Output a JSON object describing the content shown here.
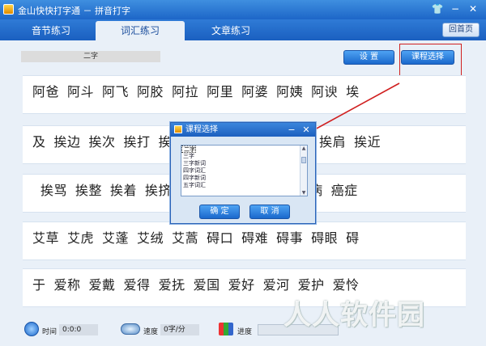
{
  "window": {
    "title": "金山快快打字通 － 拼音打字",
    "buttons": [
      "shirt-icon",
      "minimize-icon",
      "close-icon"
    ]
  },
  "tabs": [
    {
      "label": "音节练习",
      "active": false
    },
    {
      "label": "词汇练习",
      "active": true
    },
    {
      "label": "文章练习",
      "active": false
    }
  ],
  "home_button": "回首页",
  "course_label": "二字",
  "settings_button": "设  置",
  "course_select_button": "课程选择",
  "rows": [
    [
      "阿爸",
      "阿斗",
      "阿飞",
      "阿胶",
      "阿拉",
      "阿里",
      "阿婆",
      "阿姨",
      "阿谀",
      "埃"
    ],
    [
      "及",
      "挨边",
      "挨次",
      "挨打",
      "挨",
      "",
      "",
      "",
      "挨肩",
      "挨近"
    ],
    [
      "挨骂",
      "挨整",
      "挨着",
      "挨挤",
      "",
      "",
      "",
      "",
      "病",
      "癌症"
    ],
    [
      "艾草",
      "艾虎",
      "艾蓬",
      "艾绒",
      "艾蒿",
      "碍口",
      "碍难",
      "碍事",
      "碍眼",
      "碍"
    ],
    [
      "于",
      "爱称",
      "爱戴",
      "爱得",
      "爱抚",
      "爱国",
      "爱好",
      "爱河",
      "爱护",
      "爱怜"
    ]
  ],
  "dialog": {
    "title": "课程选择",
    "options": [
      "二字",
      "三字",
      "三字新词",
      "四字词汇",
      "四字新词",
      "五字词汇"
    ],
    "selected": "二字",
    "ok_button": "确  定",
    "cancel_button": "取  消"
  },
  "footer": {
    "time_label": "时间",
    "time_value": "0:0:0",
    "speed_label": "速度",
    "speed_value": "0字/分",
    "progress_label": "进度"
  },
  "watermark": "人人软件园",
  "colors": {
    "accent": "#1d66c8",
    "highlight": "#d02020"
  }
}
